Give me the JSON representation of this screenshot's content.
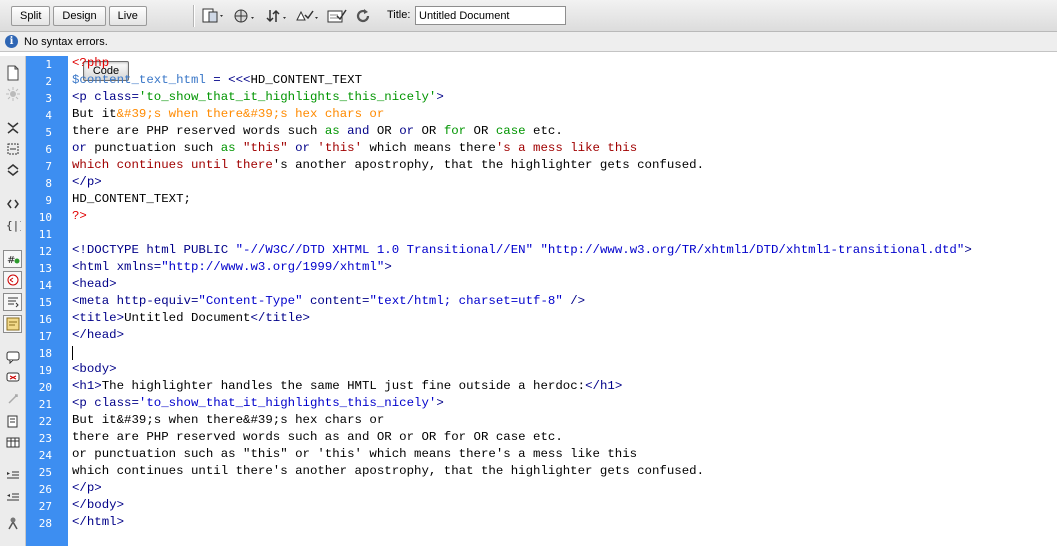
{
  "toolbar": {
    "view_buttons": [
      "Code",
      "Split",
      "Design",
      "Live"
    ],
    "active_view": "Code",
    "title_label": "Title:",
    "title_value": "Untitled Document",
    "icons": [
      "multiscreen-icon",
      "preview-globe-icon",
      "file-management-icon",
      "browser-check-icon",
      "validate-icon",
      "refresh-icon"
    ]
  },
  "status": {
    "message": "No syntax errors."
  },
  "sidebar": {
    "icons": [
      "open-documents-icon",
      "show-code-navigator-icon",
      "collapse-full-tag-icon",
      "collapse-selection-icon",
      "expand-all-icon",
      "select-parent-tag-icon",
      "balance-braces-icon",
      "line-numbers-icon",
      "highlight-invalid-code-icon",
      "word-wrap-icon",
      "syntax-coloring-icon",
      "apply-comment-icon",
      "remove-comment-icon",
      "wrap-tag-icon",
      "recent-snippets-icon",
      "move-css-icon",
      "indent-code-icon",
      "outdent-code-icon",
      "format-source-icon"
    ]
  },
  "colors": {
    "gutter": "#3d8ef1",
    "keyword_red": "#e00000",
    "tag_blue": "#0000cc",
    "variable_blue": "#3b78c8",
    "string_orange": "#ff8a00",
    "php_keyword_green": "#009500",
    "heredoc_maroon": "#a00000"
  },
  "code": {
    "line_numbers": [
      "1",
      "2",
      "3",
      "4",
      "5",
      "6",
      "7",
      "8",
      "9",
      "10",
      "11",
      "12",
      "13",
      "14",
      "15",
      "16",
      "17",
      "18",
      "19",
      "20",
      "21",
      "22",
      "23",
      "24",
      "25",
      "26",
      "27",
      "28"
    ],
    "lines": [
      [
        {
          "t": "<?php",
          "c": "red"
        }
      ],
      [
        {
          "t": "$content_text_html",
          "c": "var"
        },
        {
          "t": " = ",
          "c": "navy"
        },
        {
          "t": "<<<",
          "c": "navy"
        },
        {
          "t": "HD_CONTENT_TEXT",
          "c": "black"
        }
      ],
      [
        {
          "t": "<p class=",
          "c": "navy"
        },
        {
          "t": "'to_show_that_it_highlights_this_nicely'",
          "c": "green"
        },
        {
          "t": ">",
          "c": "navy"
        }
      ],
      [
        {
          "t": "But it",
          "c": "black"
        },
        {
          "t": "&#39;s when there&#39;s hex chars or",
          "c": "orange"
        }
      ],
      [
        {
          "t": "there are PHP reserved words such ",
          "c": "black"
        },
        {
          "t": "as",
          "c": "green"
        },
        {
          "t": " ",
          "c": "black"
        },
        {
          "t": "and",
          "c": "navy"
        },
        {
          "t": " OR ",
          "c": "black"
        },
        {
          "t": "or",
          "c": "navy"
        },
        {
          "t": " OR ",
          "c": "black"
        },
        {
          "t": "for",
          "c": "green"
        },
        {
          "t": " OR ",
          "c": "black"
        },
        {
          "t": "case",
          "c": "green"
        },
        {
          "t": " etc.",
          "c": "black"
        }
      ],
      [
        {
          "t": "or",
          "c": "navy"
        },
        {
          "t": " punctuation such ",
          "c": "black"
        },
        {
          "t": "as",
          "c": "green"
        },
        {
          "t": " ",
          "c": "black"
        },
        {
          "t": "\"this\"",
          "c": "maroon"
        },
        {
          "t": " or ",
          "c": "navy"
        },
        {
          "t": "'this'",
          "c": "maroon"
        },
        {
          "t": " which means there",
          "c": "black"
        },
        {
          "t": "'s a mess like this",
          "c": "maroon"
        }
      ],
      [
        {
          "t": "which continues until there",
          "c": "maroon"
        },
        {
          "t": "'s another apostrophy, that the highlighter gets confused.",
          "c": "black"
        }
      ],
      [
        {
          "t": "</p>",
          "c": "navy"
        }
      ],
      [
        {
          "t": "HD_CONTENT_TEXT;",
          "c": "black"
        }
      ],
      [
        {
          "t": "?>",
          "c": "red"
        }
      ],
      [],
      [
        {
          "t": "<!DOCTYPE html PUBLIC ",
          "c": "navy"
        },
        {
          "t": "\"-//W3C//DTD XHTML 1.0 Transitional//EN\"",
          "c": "blue"
        },
        {
          "t": " ",
          "c": "navy"
        },
        {
          "t": "\"http://www.w3.org/TR/xhtml1/DTD/xhtml1-transitional.dtd\"",
          "c": "blue"
        },
        {
          "t": ">",
          "c": "navy"
        }
      ],
      [
        {
          "t": "<html xmlns=",
          "c": "navy"
        },
        {
          "t": "\"http://www.w3.org/1999/xhtml\"",
          "c": "blue"
        },
        {
          "t": ">",
          "c": "navy"
        }
      ],
      [
        {
          "t": "<head>",
          "c": "navy"
        }
      ],
      [
        {
          "t": "<meta http-equiv=",
          "c": "navy"
        },
        {
          "t": "\"Content-Type\"",
          "c": "blue"
        },
        {
          "t": " content=",
          "c": "navy"
        },
        {
          "t": "\"text/html; charset=utf-8\"",
          "c": "blue"
        },
        {
          "t": " />",
          "c": "navy"
        }
      ],
      [
        {
          "t": "<title>",
          "c": "navy"
        },
        {
          "t": "Untitled Document",
          "c": "black"
        },
        {
          "t": "</title>",
          "c": "navy"
        }
      ],
      [
        {
          "t": "</head>",
          "c": "navy"
        }
      ],
      [],
      [
        {
          "t": "<body>",
          "c": "navy"
        }
      ],
      [
        {
          "t": "<h1>",
          "c": "navy"
        },
        {
          "t": "The highlighter handles the same HMTL just fine outside a herdoc:",
          "c": "black"
        },
        {
          "t": "</h1>",
          "c": "navy"
        }
      ],
      [
        {
          "t": "<p class=",
          "c": "navy"
        },
        {
          "t": "'to_show_that_it_highlights_this_nicely'",
          "c": "blue"
        },
        {
          "t": ">",
          "c": "navy"
        }
      ],
      [
        {
          "t": "But it&#39;s when there&#39;s hex chars or",
          "c": "black"
        }
      ],
      [
        {
          "t": "there are PHP reserved words such as and OR or OR for OR case etc.",
          "c": "black"
        }
      ],
      [
        {
          "t": "or punctuation such as \"this\" or 'this' which means there's a mess like this",
          "c": "black"
        }
      ],
      [
        {
          "t": "which continues until there's another apostrophy, that the highlighter gets confused.",
          "c": "black"
        }
      ],
      [
        {
          "t": "</p>",
          "c": "navy"
        }
      ],
      [
        {
          "t": "</body>",
          "c": "navy"
        }
      ],
      [
        {
          "t": "</html>",
          "c": "navy"
        }
      ]
    ]
  }
}
